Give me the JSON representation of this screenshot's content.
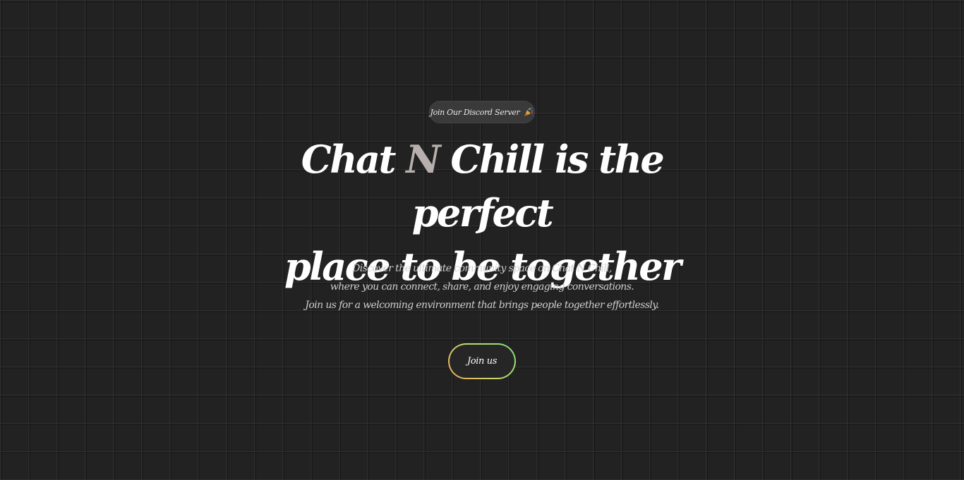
{
  "badge": {
    "label": "Join Our Discord Server",
    "icon": "party-popper-icon"
  },
  "headline": {
    "part1": "Chat ",
    "accent": "N",
    "part2": " Chill is the perfect",
    "line2": "place to be together"
  },
  "description": {
    "line1": "Discover the ultimate community space on Chat N Chill,",
    "line2": "where you can connect, share, and enjoy engaging conversations.",
    "line3": "Join us for a welcoming environment that brings people together effortlessly."
  },
  "cta": {
    "label": "Join us"
  },
  "colors": {
    "background": "#222222",
    "accent_letter": "#b7b0ae",
    "button_gradient_start": "#f2a65a",
    "button_gradient_end": "#7fe07a"
  }
}
